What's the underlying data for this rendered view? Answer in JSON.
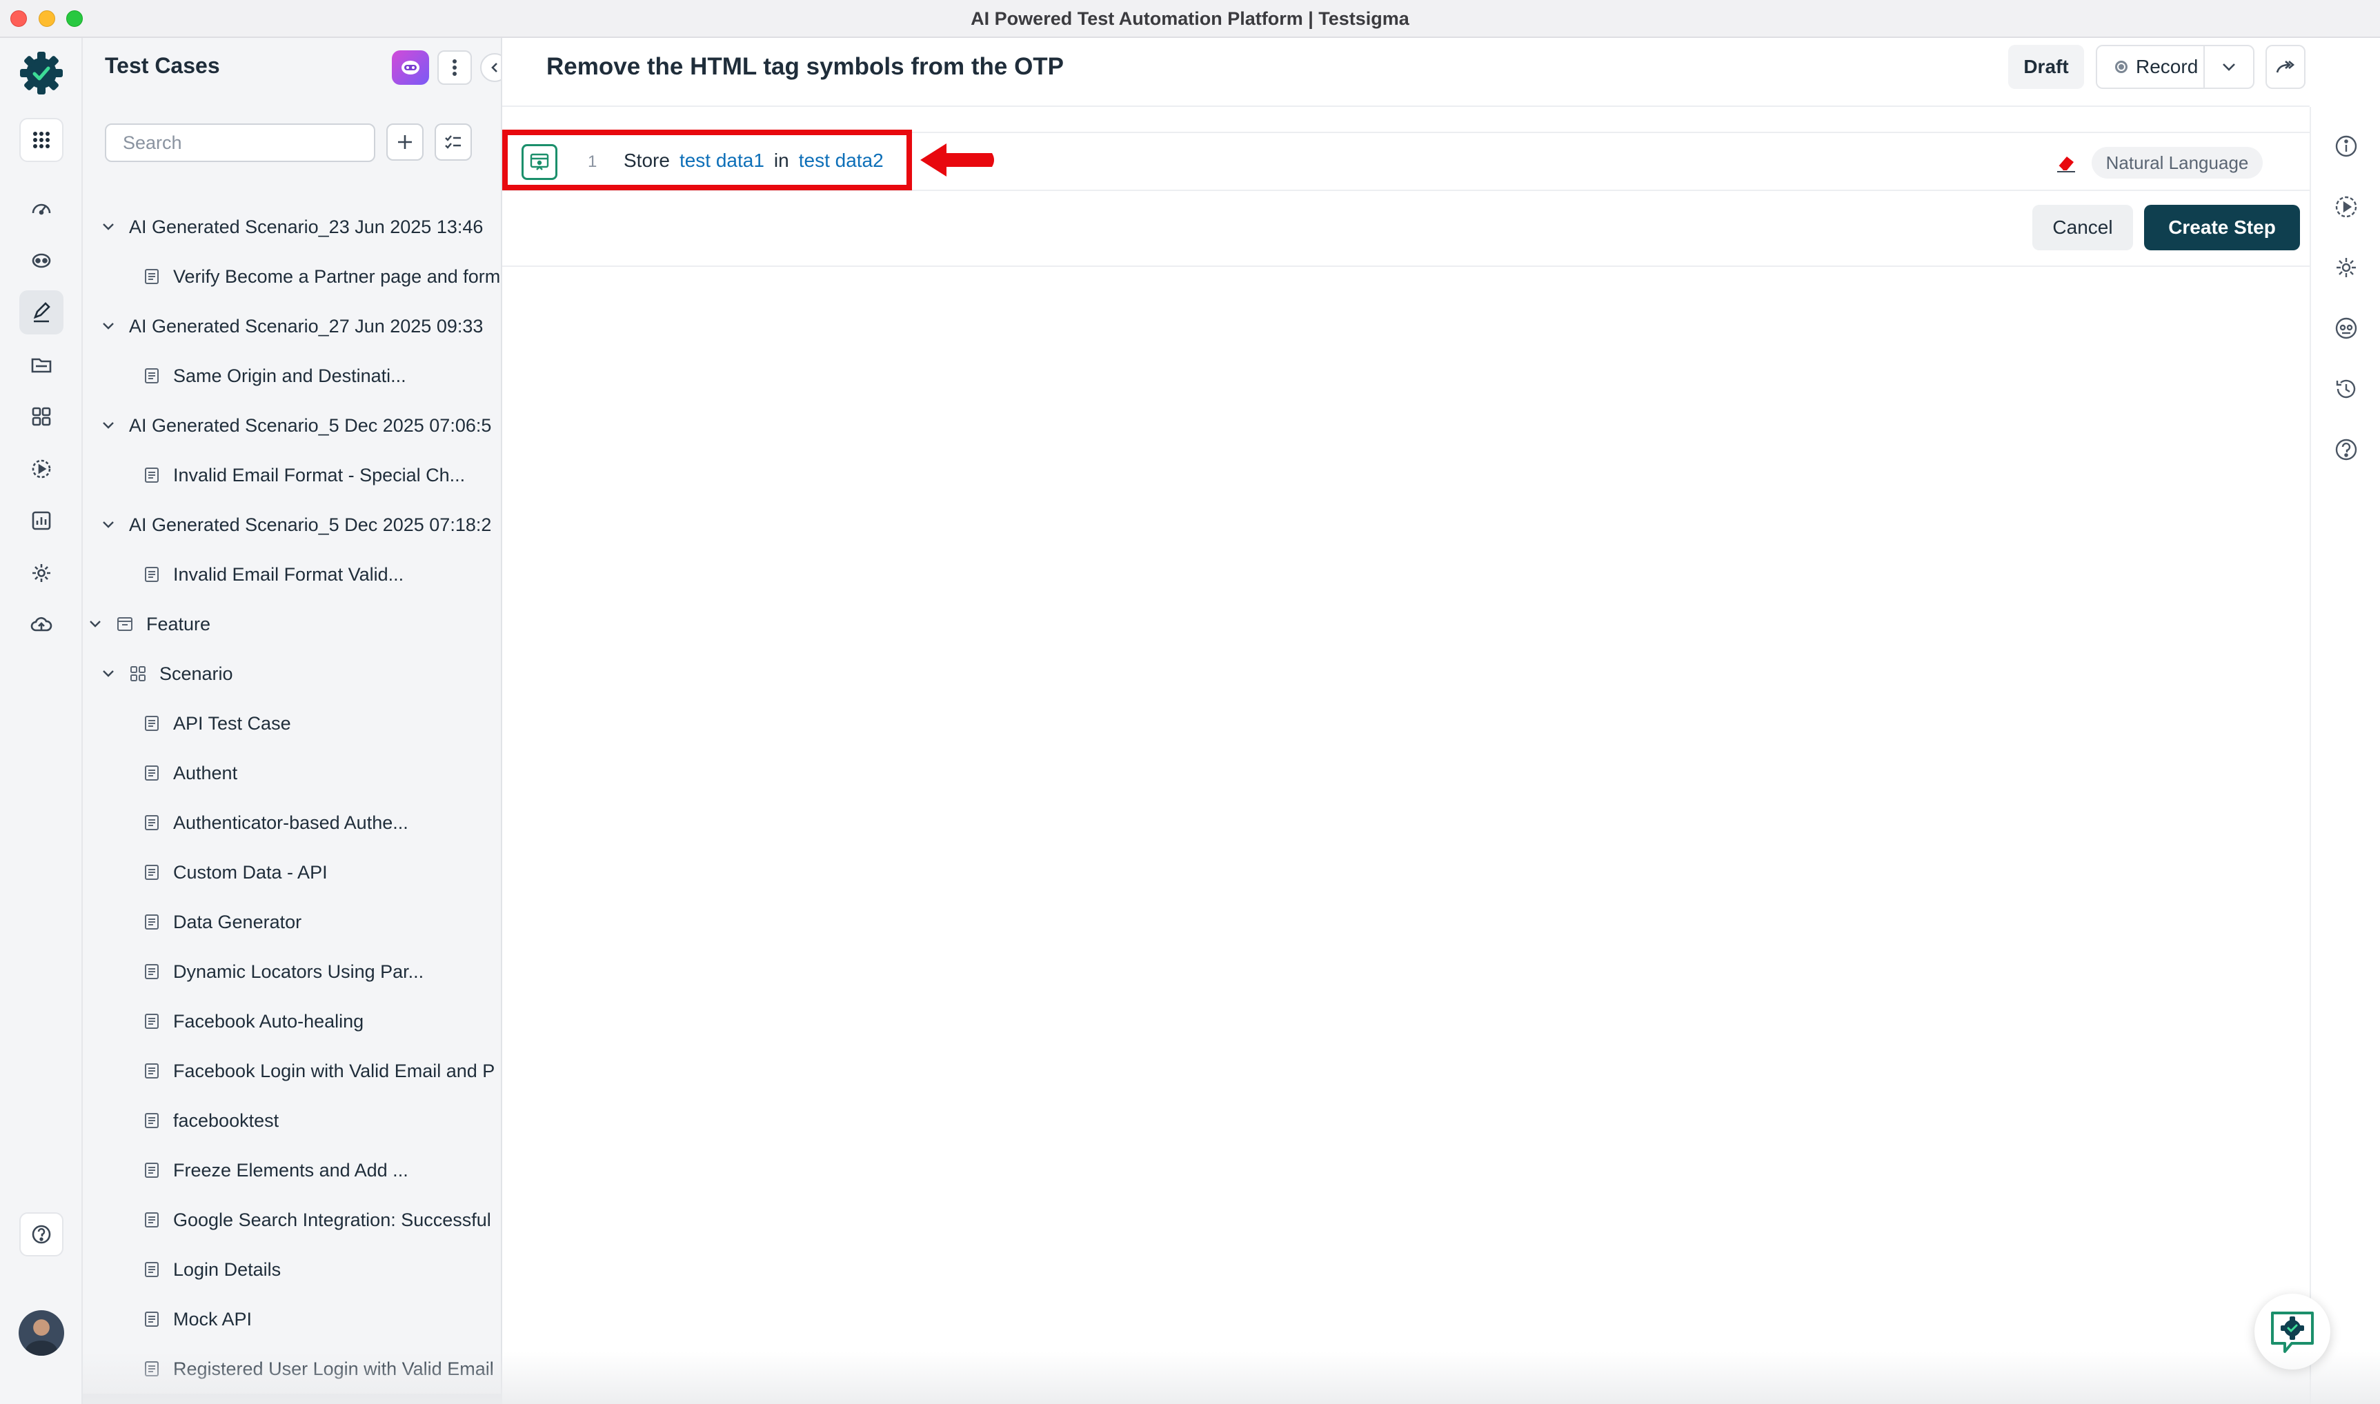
{
  "window": {
    "title": "AI Powered Test Automation Platform | Testsigma"
  },
  "rail": {
    "icons": [
      "apps-grid-icon",
      "dashboard-gauge-icon",
      "copilot-bot-icon",
      "test-cases-edit-icon",
      "test-data-folder-icon",
      "elements-grid-icon",
      "runs-play-icon",
      "reports-chart-icon",
      "settings-gear-icon",
      "upload-cloud-icon",
      "help-icon"
    ]
  },
  "panel": {
    "title": "Test Cases",
    "search_placeholder": "Search",
    "tree": [
      {
        "label": "AI Generated Scenario_23 Jun 2025 13:46",
        "kind": "scenario"
      },
      {
        "label": "Verify Become a Partner page and form",
        "kind": "case"
      },
      {
        "label": "AI Generated Scenario_27 Jun 2025 09:33",
        "kind": "scenario"
      },
      {
        "label": "Same Origin and Destinati...",
        "kind": "case"
      },
      {
        "label": "AI Generated Scenario_5 Dec 2025 07:06:5",
        "kind": "scenario"
      },
      {
        "label": "Invalid Email Format - Special Ch...",
        "kind": "case"
      },
      {
        "label": "AI Generated Scenario_5 Dec 2025 07:18:2",
        "kind": "scenario"
      },
      {
        "label": "Invalid Email Format Valid...",
        "kind": "case"
      },
      {
        "label": "Feature",
        "kind": "feature"
      },
      {
        "label": "Scenario",
        "kind": "scenario-group"
      },
      {
        "label": "API Test Case",
        "kind": "case2"
      },
      {
        "label": "Authent",
        "kind": "case2"
      },
      {
        "label": "Authenticator-based Authe...",
        "kind": "case2"
      },
      {
        "label": "Custom Data - API",
        "kind": "case2"
      },
      {
        "label": "Data Generator",
        "kind": "case2"
      },
      {
        "label": "Dynamic Locators Using Par...",
        "kind": "case2"
      },
      {
        "label": "Facebook Auto-healing",
        "kind": "case2"
      },
      {
        "label": "Facebook Login with Valid Email and P",
        "kind": "case2"
      },
      {
        "label": "facebooktest",
        "kind": "case2"
      },
      {
        "label": "Freeze Elements and Add ...",
        "kind": "case2"
      },
      {
        "label": "Google Search Integration: Successful",
        "kind": "case2"
      },
      {
        "label": "Login Details",
        "kind": "case2"
      },
      {
        "label": "Mock API",
        "kind": "case2"
      },
      {
        "label": "Registered User Login with Valid Email",
        "kind": "case2"
      },
      {
        "label": "Remove the HTML tag symbols from",
        "kind": "case2",
        "selected": true
      }
    ]
  },
  "main": {
    "title": "Remove the HTML tag symbols from the OTP",
    "status": "Draft",
    "record_label": "Record",
    "step": {
      "number": "1",
      "action": "Store",
      "param1": "test data1",
      "connector": "in",
      "param2": "test data2",
      "mode": "Natural Language"
    },
    "cancel_label": "Cancel",
    "create_label": "Create Step"
  },
  "right_rail": {
    "icons": [
      "info-icon",
      "run-icon",
      "settings-icon",
      "ai-agent-icon",
      "history-icon",
      "help-icon"
    ]
  },
  "colors": {
    "brand_dark": "#0f3f4f",
    "token_blue": "#0d6fb8",
    "highlight_red": "#e8080e",
    "step_icon_green": "#1b8f6b"
  }
}
